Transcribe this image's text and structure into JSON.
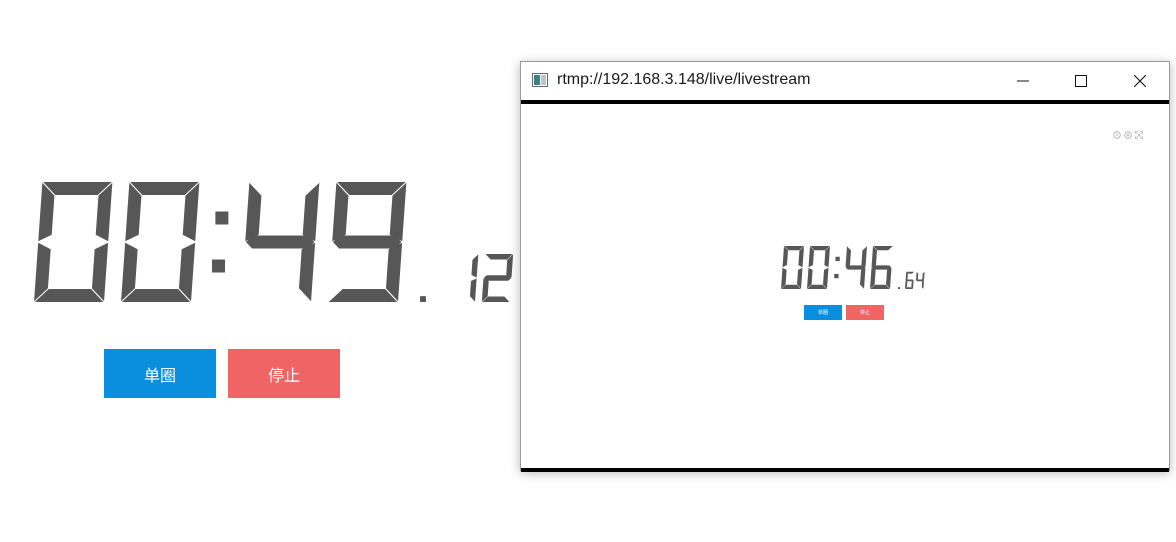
{
  "stopwatch": {
    "minutes": "00",
    "seconds": "49",
    "separator": ":",
    "decimal_point": ".",
    "hundredths": "12",
    "digit_color": "#575757"
  },
  "buttons": {
    "lap_label": "单圈",
    "stop_label": "停止",
    "lap_color": "#0a8fde",
    "stop_color": "#f06466"
  },
  "player_window": {
    "title": "rtmp://192.168.3.148/live/livestream",
    "icons": [
      "app-icon",
      "minimize-icon",
      "maximize-icon",
      "close-icon"
    ],
    "stream": {
      "minutes": "00",
      "seconds": "46",
      "separator": ":",
      "decimal_point": ".",
      "hundredths": "64",
      "lap_label": "单圈",
      "stop_label": "停止",
      "overlay_icons": [
        "zoom-out-icon",
        "zoom-in-icon",
        "fullscreen-icon"
      ]
    }
  }
}
